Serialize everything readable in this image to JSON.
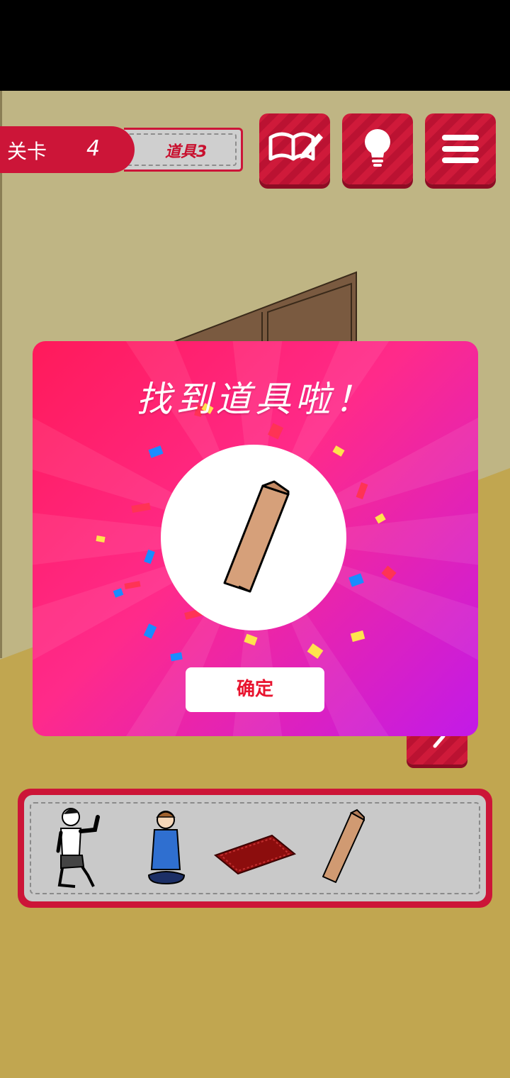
{
  "hud": {
    "level_label": "关卡",
    "level_number": "4",
    "item_label": "道具3",
    "buttons": [
      {
        "name": "guide-button",
        "icon": "book-pencil-icon"
      },
      {
        "name": "hint-button",
        "icon": "lightbulb-icon"
      },
      {
        "name": "menu-button",
        "icon": "hamburger-menu-icon"
      }
    ]
  },
  "popup": {
    "title": "找到道具啦！",
    "item_icon": "wooden-plank-icon",
    "confirm_label": "确定"
  },
  "inventory": {
    "items": [
      {
        "icon": "muscle-man-icon"
      },
      {
        "icon": "seated-boy-icon"
      },
      {
        "icon": "red-mat-icon"
      },
      {
        "icon": "wooden-plank-icon"
      }
    ]
  },
  "colors": {
    "accent_red": "#cc1538",
    "popup_gradient_start": "#ff1a5a",
    "popup_gradient_end": "#c21ae8",
    "wall": "#bfb584",
    "floor": "#c1a650"
  }
}
